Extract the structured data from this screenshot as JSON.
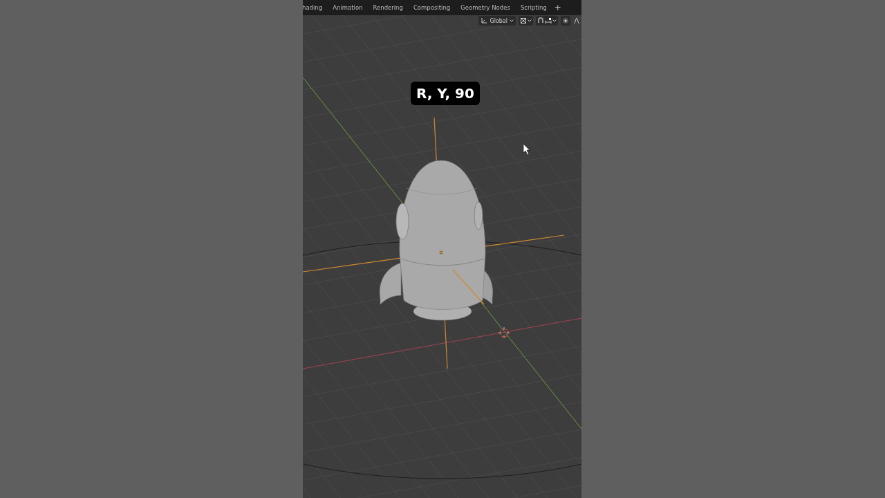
{
  "workspace_tabs": [
    {
      "label": "hading"
    },
    {
      "label": "Animation"
    },
    {
      "label": "Rendering"
    },
    {
      "label": "Compositing"
    },
    {
      "label": "Geometry Nodes"
    },
    {
      "label": "Scripting"
    }
  ],
  "add_tab": "+",
  "header": {
    "orientation": "Global"
  },
  "caption": "R, Y, 90"
}
